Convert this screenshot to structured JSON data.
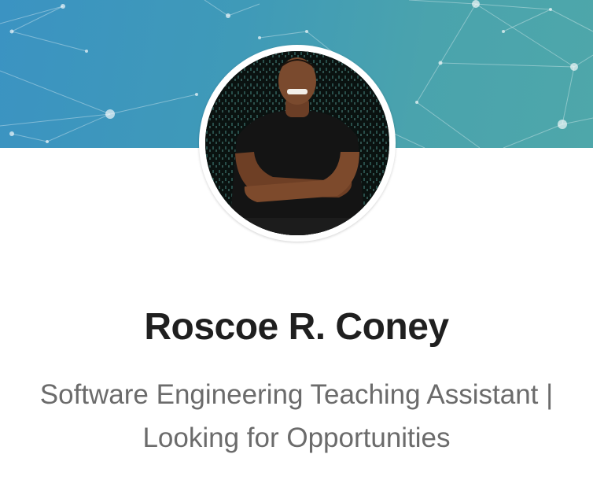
{
  "profile": {
    "name": "Roscoe R. Coney",
    "headline": "Software Engineering Teaching Assistant | Looking for Opportunities"
  },
  "icons": {
    "avatar": "profile-photo"
  },
  "colors": {
    "banner_start": "#3b93c2",
    "banner_end": "#4ea7aa",
    "name_text": "#1f1f1f",
    "headline_text": "#6b6b6b"
  }
}
